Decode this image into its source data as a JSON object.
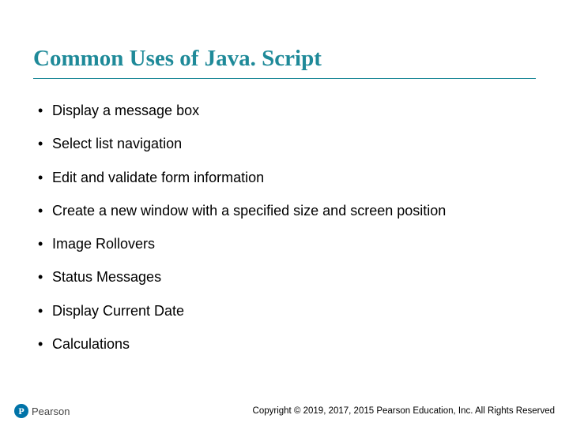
{
  "slide": {
    "title": "Common Uses of Java. Script",
    "bullets": [
      "Display a message box",
      "Select list navigation",
      "Edit and validate form information",
      "Create a new window with a specified size and screen position",
      "Image Rollovers",
      "Status Messages",
      "Display Current Date",
      "Calculations"
    ]
  },
  "footer": {
    "logo_letter": "P",
    "logo_text": "Pearson",
    "copyright": "Copyright © 2019, 2017, 2015 Pearson Education, Inc. All Rights Reserved"
  }
}
